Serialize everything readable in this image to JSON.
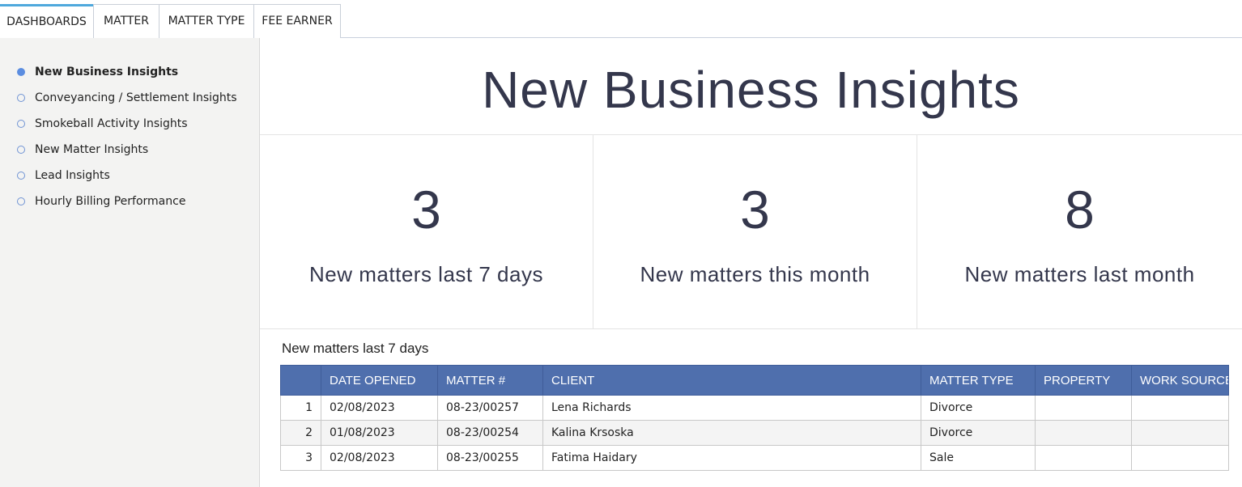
{
  "tabs": [
    {
      "label": "DASHBOARDS",
      "active": true
    },
    {
      "label": "MATTER",
      "active": false
    },
    {
      "label": "MATTER TYPE",
      "active": false
    },
    {
      "label": "FEE EARNER",
      "active": false
    }
  ],
  "sidebar": {
    "items": [
      {
        "label": "New Business Insights",
        "active": true
      },
      {
        "label": "Conveyancing / Settlement Insights",
        "active": false
      },
      {
        "label": "Smokeball Activity Insights",
        "active": false
      },
      {
        "label": "New Matter Insights",
        "active": false
      },
      {
        "label": "Lead Insights",
        "active": false
      },
      {
        "label": "Hourly Billing Performance",
        "active": false
      }
    ]
  },
  "main": {
    "title": "New Business Insights",
    "kpis": [
      {
        "value": "3",
        "label": "New matters last 7 days"
      },
      {
        "value": "3",
        "label": "New matters this month"
      },
      {
        "value": "8",
        "label": "New matters last month"
      }
    ],
    "table": {
      "title": "New matters last 7 days",
      "columns": [
        "",
        "DATE OPENED",
        "MATTER #",
        "CLIENT",
        "MATTER TYPE",
        "PROPERTY",
        "WORK SOURCE"
      ],
      "rows": [
        [
          "1",
          "02/08/2023",
          "08-23/00257",
          "Lena Richards",
          "Divorce",
          "",
          ""
        ],
        [
          "2",
          "01/08/2023",
          "08-23/00254",
          "Kalina Krsoska",
          "Divorce",
          "",
          ""
        ],
        [
          "3",
          "02/08/2023",
          "08-23/00255",
          "Fatima Haidary",
          "Sale",
          "",
          ""
        ]
      ]
    }
  },
  "colors": {
    "accent_tab": "#4ea8dc",
    "nav_dot": "#5b8de0",
    "table_header": "#4f6fad",
    "title_text": "#34374c"
  }
}
